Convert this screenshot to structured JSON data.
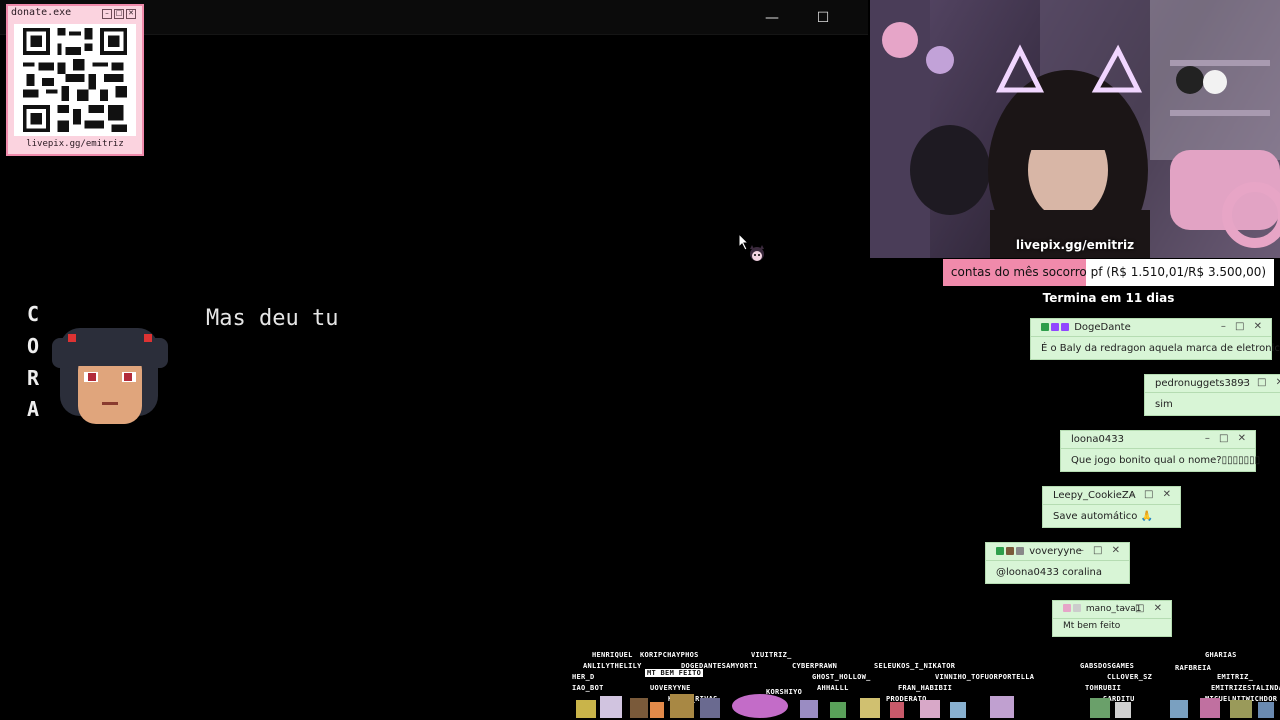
{
  "game_window": {
    "minimize_icon": "minimize-icon",
    "maximize_icon": "maximize-icon",
    "minimize_glyph": "—",
    "maximize_glyph": "☐"
  },
  "donate": {
    "title": "donate.exe",
    "url": "livepix.gg/emitriz",
    "controls": [
      "–",
      "□",
      "✕"
    ]
  },
  "dialogue": {
    "speaker_letters": [
      "C",
      "O",
      "R",
      "A"
    ],
    "text": "Mas deu tu"
  },
  "webcam": {
    "caption": "livepix.gg/emitriz"
  },
  "goal": {
    "text": "contas do mês socorro pf (R$ 1.510,01/R$ 3.500,00)",
    "current": 1510.01,
    "target": 3500.0,
    "deadline": "Termina em 11 dias",
    "fill_color": "#f08aab"
  },
  "chat": [
    {
      "user": "DogeDante",
      "message": "É o Baly da redragon aquela marca de eletronicos"
    },
    {
      "user": "pedronuggets3893",
      "message": "sim"
    },
    {
      "user": "loona0433",
      "message": "Que jogo bonito qual o nome?▯▯▯▯▯▯▯"
    },
    {
      "user": "Leepy_CookieZA",
      "message": "Save automático 🙏"
    },
    {
      "user": "voveryyne",
      "message": "@loona0433 coralina"
    },
    {
      "user": "mano_tava1",
      "message": "Mt bem feito"
    }
  ],
  "chat_controls": "– □ ✕",
  "sprite_names": [
    "HENRIQUEL",
    "KORIPCHAYPHOS",
    "VIUITRIZ_",
    "GHARIAS",
    "ANLILYTHELILY",
    "DOGEDANTESAMYORT1",
    "CYBERPRAWN",
    "SELEUKOS_I_NIKATOR",
    "GABSDOSGAMES",
    "RAFBREIA",
    "HER_D",
    "MT BEM FEITO",
    "GHOST_HOLLOW_",
    "VINNIHO_TOFUORPORTELLA",
    "CLLOVER_SZ",
    "EMITRIZ_",
    "IAO_BOT",
    "UOVERYYNE",
    "KORSHIYO",
    "AHHALLL",
    "FRAN_HABIBII",
    "TOHRUBII",
    "EMITRIZESTALINDA",
    "KEANU_RIVAS",
    "PRODERATO",
    "SARDITU",
    "MIGUELNITWICHDOR"
  ],
  "colors": {
    "chat_bg": "#d8f5d6",
    "donate_bg": "#fbd3df",
    "accent_pink": "#f08aab"
  }
}
